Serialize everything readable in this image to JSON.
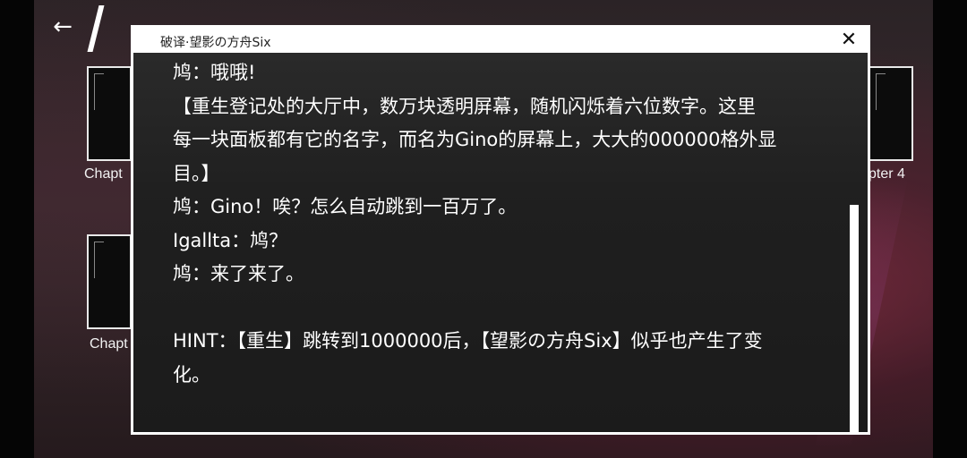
{
  "nav": {
    "back_icon": "arrow-left-icon",
    "back_glyph": "←"
  },
  "chapters": {
    "top_left_label": "Chapt",
    "top_right_label": "pter 4",
    "bottom_left_label": "Chapt"
  },
  "dialog": {
    "title": "破译·望影の方舟Six",
    "close_icon": "close-icon",
    "close_glyph": "✕",
    "lines": [
      "鸠：哦哦!",
      "【重生登记处的大厅中，数万块透明屏幕，随机闪烁着六位数字。这里",
      "每一块面板都有它的名字，而名为Gino的屏幕上，大大的000000格外显",
      "目。】",
      "鸠：Gino！唉？怎么自动跳到一百万了。",
      "Igallta：鸠？",
      "鸠：来了来了。",
      "",
      "HINT：【重生】跳转到1000000后，【望影の方舟Six】似乎也产生了变",
      "化。"
    ]
  },
  "colors": {
    "modal_border": "#ffffff",
    "modal_body": "#1f1f1f",
    "text": "#ffffff",
    "background_accent": "#962d46"
  }
}
